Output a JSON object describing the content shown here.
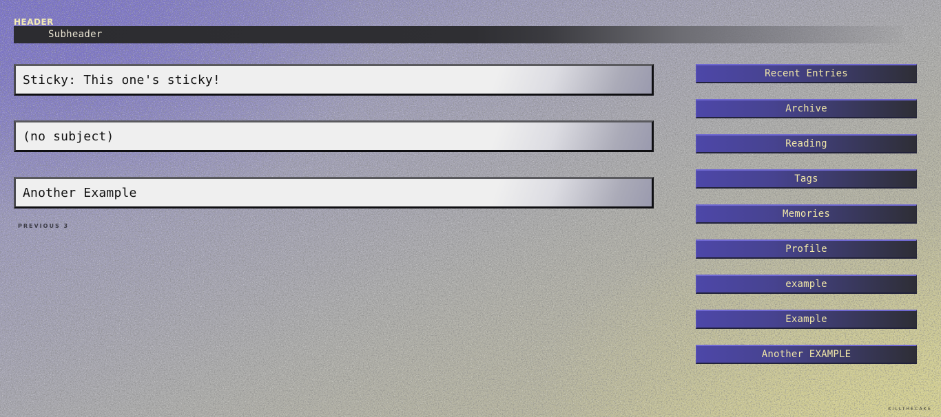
{
  "header": {
    "title": "HEADER",
    "subheader": "Subheader"
  },
  "entries": [
    {
      "subject": "Sticky: This one's sticky!"
    },
    {
      "subject": "(no subject)"
    },
    {
      "subject": "Another Example"
    }
  ],
  "navigation": {
    "previous_label": "PREVIOUS 3"
  },
  "sidebar": {
    "items": [
      {
        "label": "Recent Entries"
      },
      {
        "label": "Archive"
      },
      {
        "label": "Reading"
      },
      {
        "label": "Tags"
      },
      {
        "label": "Memories"
      },
      {
        "label": "Profile"
      },
      {
        "label": "example"
      },
      {
        "label": "Example"
      },
      {
        "label": "Another EXAMPLE"
      }
    ]
  },
  "footer": {
    "credit": "KILLTHECAKE"
  },
  "colors": {
    "header_text": "#f3ebb4",
    "nav_text": "#f1e7a8",
    "nav_bg": "#4d47a8",
    "entry_bg": "#efefef",
    "subheader_bar": "#2c2c30"
  }
}
